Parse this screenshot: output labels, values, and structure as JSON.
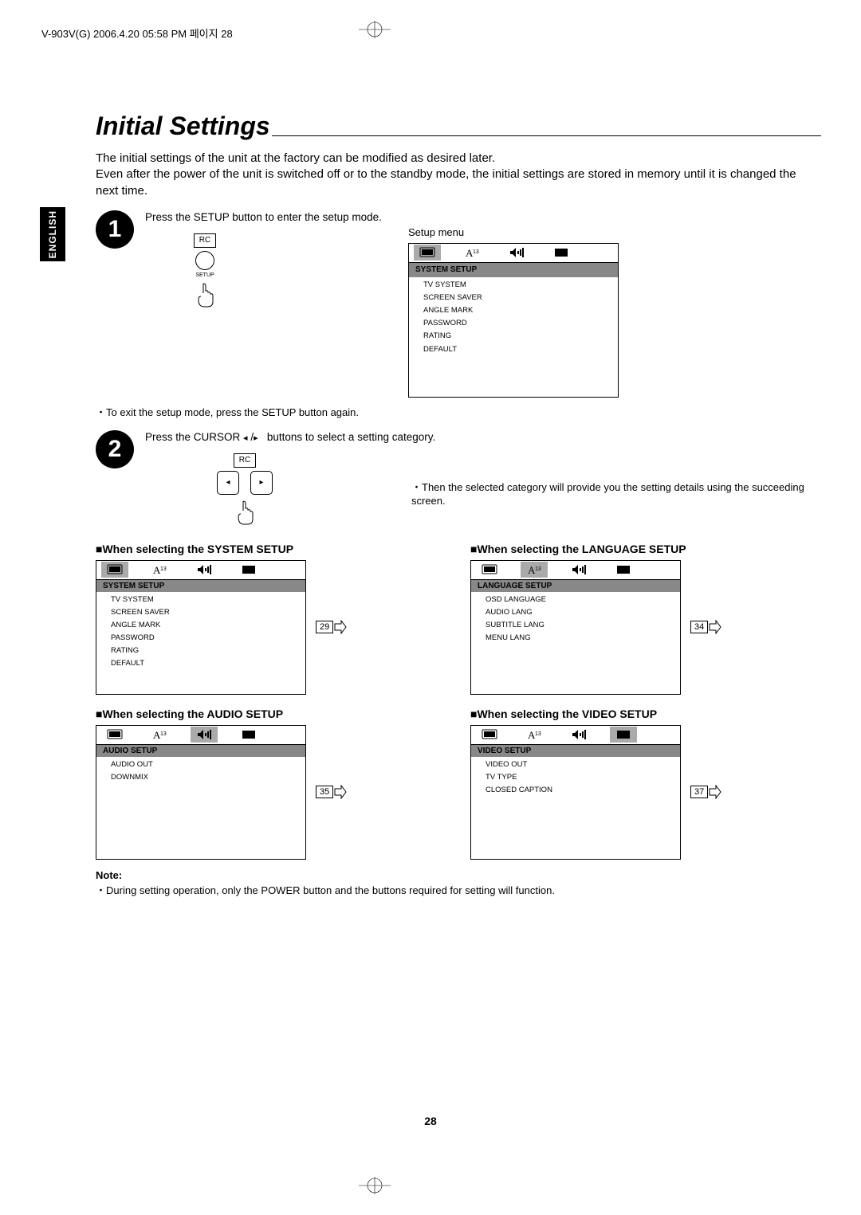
{
  "header": "V-903V(G)  2006.4.20  05:58 PM  페이지 28",
  "side_tab": "ENGLISH",
  "title": "Initial Settings",
  "intro_lines": [
    "The initial settings of the unit at the factory can be modified as desired later.",
    "Even after the power of the unit is switched off or to the standby mode, the initial settings are stored in memory until it is changed the next time."
  ],
  "step1": {
    "num": "1",
    "text": "Press the SETUP button to enter the setup mode.",
    "rc": "RC",
    "setup_label": "SETUP",
    "setup_menu_label": "Setup menu",
    "screen": {
      "title": "SYSTEM SETUP",
      "items": [
        "TV SYSTEM",
        "SCREEN SAVER",
        "ANGLE MARK",
        "PASSWORD",
        "RATING",
        "DEFAULT"
      ]
    },
    "exit_note": "・To exit the setup mode, press the SETUP button again."
  },
  "step2": {
    "num": "2",
    "text_pre": "Press the CURSOR ",
    "text_post": " buttons to select a setting category.",
    "rc": "RC",
    "follow_note": "・Then the selected category will provide you the setting details using the succeeding screen."
  },
  "grid": [
    {
      "heading": "■When selecting the SYSTEM SETUP",
      "sel": 0,
      "title": "SYSTEM SETUP",
      "items": [
        "TV SYSTEM",
        "SCREEN SAVER",
        "ANGLE MARK",
        "PASSWORD",
        "RATING",
        "DEFAULT"
      ],
      "ref": "29"
    },
    {
      "heading": "■When selecting the LANGUAGE SETUP",
      "sel": 1,
      "title": "LANGUAGE SETUP",
      "items": [
        "OSD LANGUAGE",
        "AUDIO LANG",
        "SUBTITLE LANG",
        "MENU LANG"
      ],
      "ref": "34"
    },
    {
      "heading": "■When selecting the AUDIO SETUP",
      "sel": 2,
      "title": "AUDIO SETUP",
      "items": [
        "AUDIO OUT",
        "DOWNMIX"
      ],
      "ref": "35"
    },
    {
      "heading": "■When selecting the VIDEO SETUP",
      "sel": 3,
      "title": "VIDEO SETUP",
      "items": [
        "VIDEO  OUT",
        "TV TYPE",
        "CLOSED CAPTION"
      ],
      "ref": "37"
    }
  ],
  "note": {
    "label": "Note:",
    "text": "・During setting operation, only the POWER button and the buttons required for setting will function."
  },
  "page_number": "28"
}
